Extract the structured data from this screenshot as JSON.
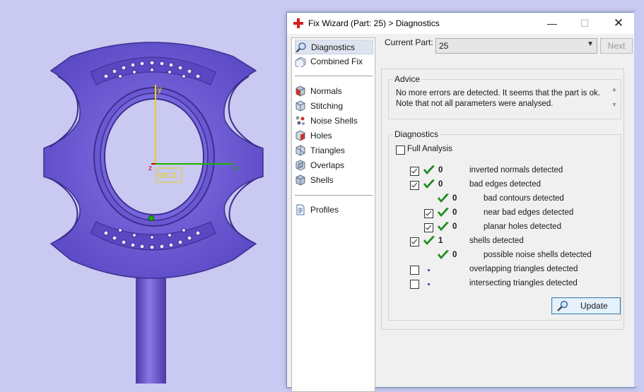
{
  "viewport": {
    "axis_labels": {
      "y": "y",
      "x": "x",
      "z": "z"
    },
    "wcs_label": "WCS",
    "colors": {
      "background": "#c9c9f2",
      "model": "#6f5bd6",
      "model_dark": "#4b3aa3",
      "y_axis": "#e8d300",
      "x_axis": "#1bb300",
      "z_axis": "#d40000"
    }
  },
  "dialog": {
    "title": "Fix Wizard (Part: 25) > Diagnostics",
    "controls": {
      "minimize": "—",
      "maximize": "☐",
      "close": "✕"
    },
    "nav": {
      "top_items": [
        {
          "label": "Diagnostics",
          "icon": "magnifier-icon",
          "selected": true
        },
        {
          "label": "Combined Fix",
          "icon": "combined-fix-icon"
        }
      ],
      "fix_items": [
        {
          "label": "Normals",
          "icon": "normals-cube-icon"
        },
        {
          "label": "Stitching",
          "icon": "stitching-cube-icon"
        },
        {
          "label": "Noise Shells",
          "icon": "noise-shells-icon"
        },
        {
          "label": "Holes",
          "icon": "holes-cube-icon"
        },
        {
          "label": "Triangles",
          "icon": "triangles-cube-icon"
        },
        {
          "label": "Overlaps",
          "icon": "overlaps-cube-icon"
        },
        {
          "label": "Shells",
          "icon": "shells-cube-icon"
        }
      ],
      "bottom_items": [
        {
          "label": "Profiles",
          "icon": "document-icon"
        }
      ]
    },
    "current_part": {
      "label": "Current Part:",
      "value": "25"
    },
    "next_button": "Next",
    "advice": {
      "title": "Advice",
      "lines": [
        "No more errors are detected. It seems that the part is ok.",
        "Note that not all parameters were analysed."
      ]
    },
    "diagnostics": {
      "title": "Diagnostics",
      "full_analysis": {
        "label": "Full Analysis",
        "checked": false
      },
      "rows": [
        {
          "checkbox": true,
          "checked": true,
          "status": "tick",
          "value": "0",
          "label": "inverted normals detected",
          "indent": 0
        },
        {
          "checkbox": true,
          "checked": true,
          "status": "tick",
          "value": "0",
          "label": "bad edges detected",
          "indent": 0
        },
        {
          "checkbox": false,
          "checked": false,
          "status": "tick",
          "value": "0",
          "label": "bad contours detected",
          "indent": 1
        },
        {
          "checkbox": true,
          "checked": true,
          "status": "tick",
          "value": "0",
          "label": "near bad edges detected",
          "indent": 1
        },
        {
          "checkbox": true,
          "checked": true,
          "status": "tick",
          "value": "0",
          "label": "planar holes detected",
          "indent": 1
        },
        {
          "checkbox": true,
          "checked": true,
          "status": "tick",
          "value": "1",
          "label": "shells detected",
          "indent": 0
        },
        {
          "checkbox": false,
          "checked": false,
          "status": "tick",
          "value": "0",
          "label": "possible noise shells detected",
          "indent": 1
        },
        {
          "checkbox": true,
          "checked": false,
          "status": "dot",
          "value": "",
          "label": "overlapping triangles detected",
          "indent": 0
        },
        {
          "checkbox": true,
          "checked": false,
          "status": "dot",
          "value": "",
          "label": "intersecting triangles detected",
          "indent": 0
        }
      ],
      "update_button": "Update"
    },
    "colors": {
      "accent": "#3c7fb1",
      "tick_green": "#1e8c1e",
      "dot_blue": "#1f3fa8"
    }
  }
}
